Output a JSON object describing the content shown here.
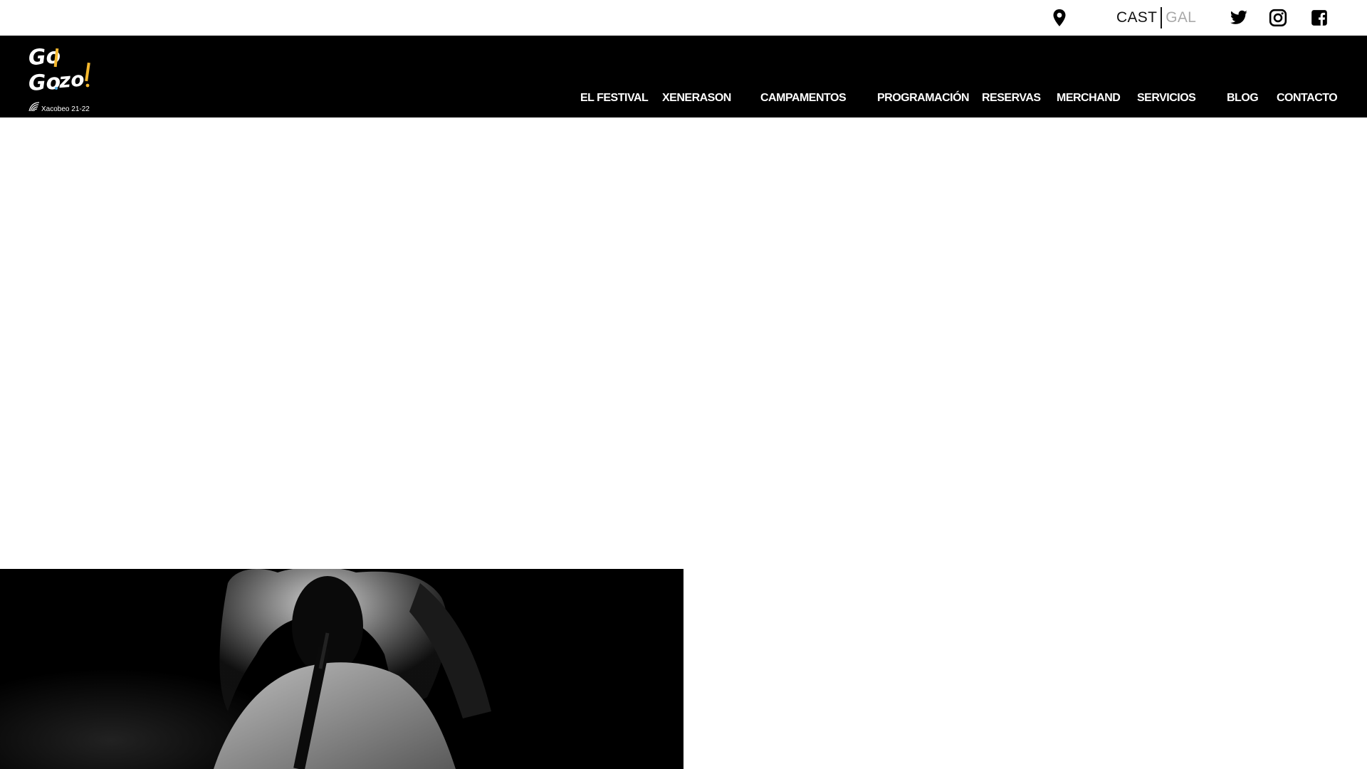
{
  "topbar": {
    "location_icon": "map-pin-icon",
    "languages": {
      "active": "CAST",
      "inactive": "GAL"
    },
    "social": [
      "twitter-icon",
      "instagram-icon",
      "facebook-icon"
    ]
  },
  "header": {
    "logo": {
      "line1": "Go",
      "line2": "Go",
      "line2_suffix": "zo!",
      "subtitle": "Xacobeo 21-22"
    },
    "nav": [
      {
        "label": "EL FESTIVAL",
        "name": "nav-el-festival"
      },
      {
        "label": "XENERASON",
        "name": "nav-xenerason"
      },
      {
        "label": "CAMPAMENTOS",
        "name": "nav-campamentos"
      },
      {
        "label": "PROGRAMACIÓN",
        "name": "nav-programacion"
      },
      {
        "label": "RESERVAS",
        "name": "nav-reservas"
      },
      {
        "label": "MERCHAND",
        "name": "nav-merchand"
      },
      {
        "label": "SERVICIOS",
        "name": "nav-servicios"
      },
      {
        "label": "BLOG",
        "name": "nav-blog"
      },
      {
        "label": "CONTACTO",
        "name": "nav-contacto"
      }
    ]
  },
  "colors": {
    "nav_background": "#000000",
    "nav_text": "#ffffff",
    "logo_accent": "#f5b82e",
    "inactive_language": "#a9a9a9"
  }
}
